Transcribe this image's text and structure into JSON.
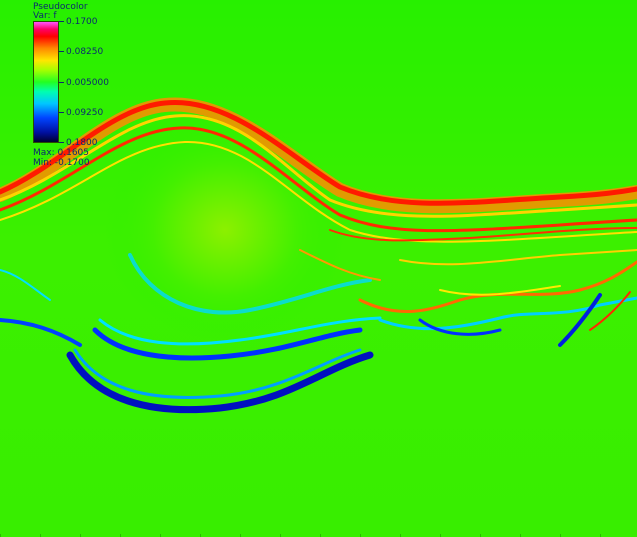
{
  "legend": {
    "title": "Pseudocolor",
    "variable": "Var: f",
    "ticks": [
      "0.1700",
      "0.08250",
      "0.005000",
      "0.09250",
      "0.1800"
    ],
    "max_label": "Max: 0.1605",
    "min_label": "Min: -0.1700"
  },
  "colors": {
    "background": "#22f000",
    "high": "#ff0000",
    "mid": "#22ff22",
    "low": "#0010a0"
  }
}
